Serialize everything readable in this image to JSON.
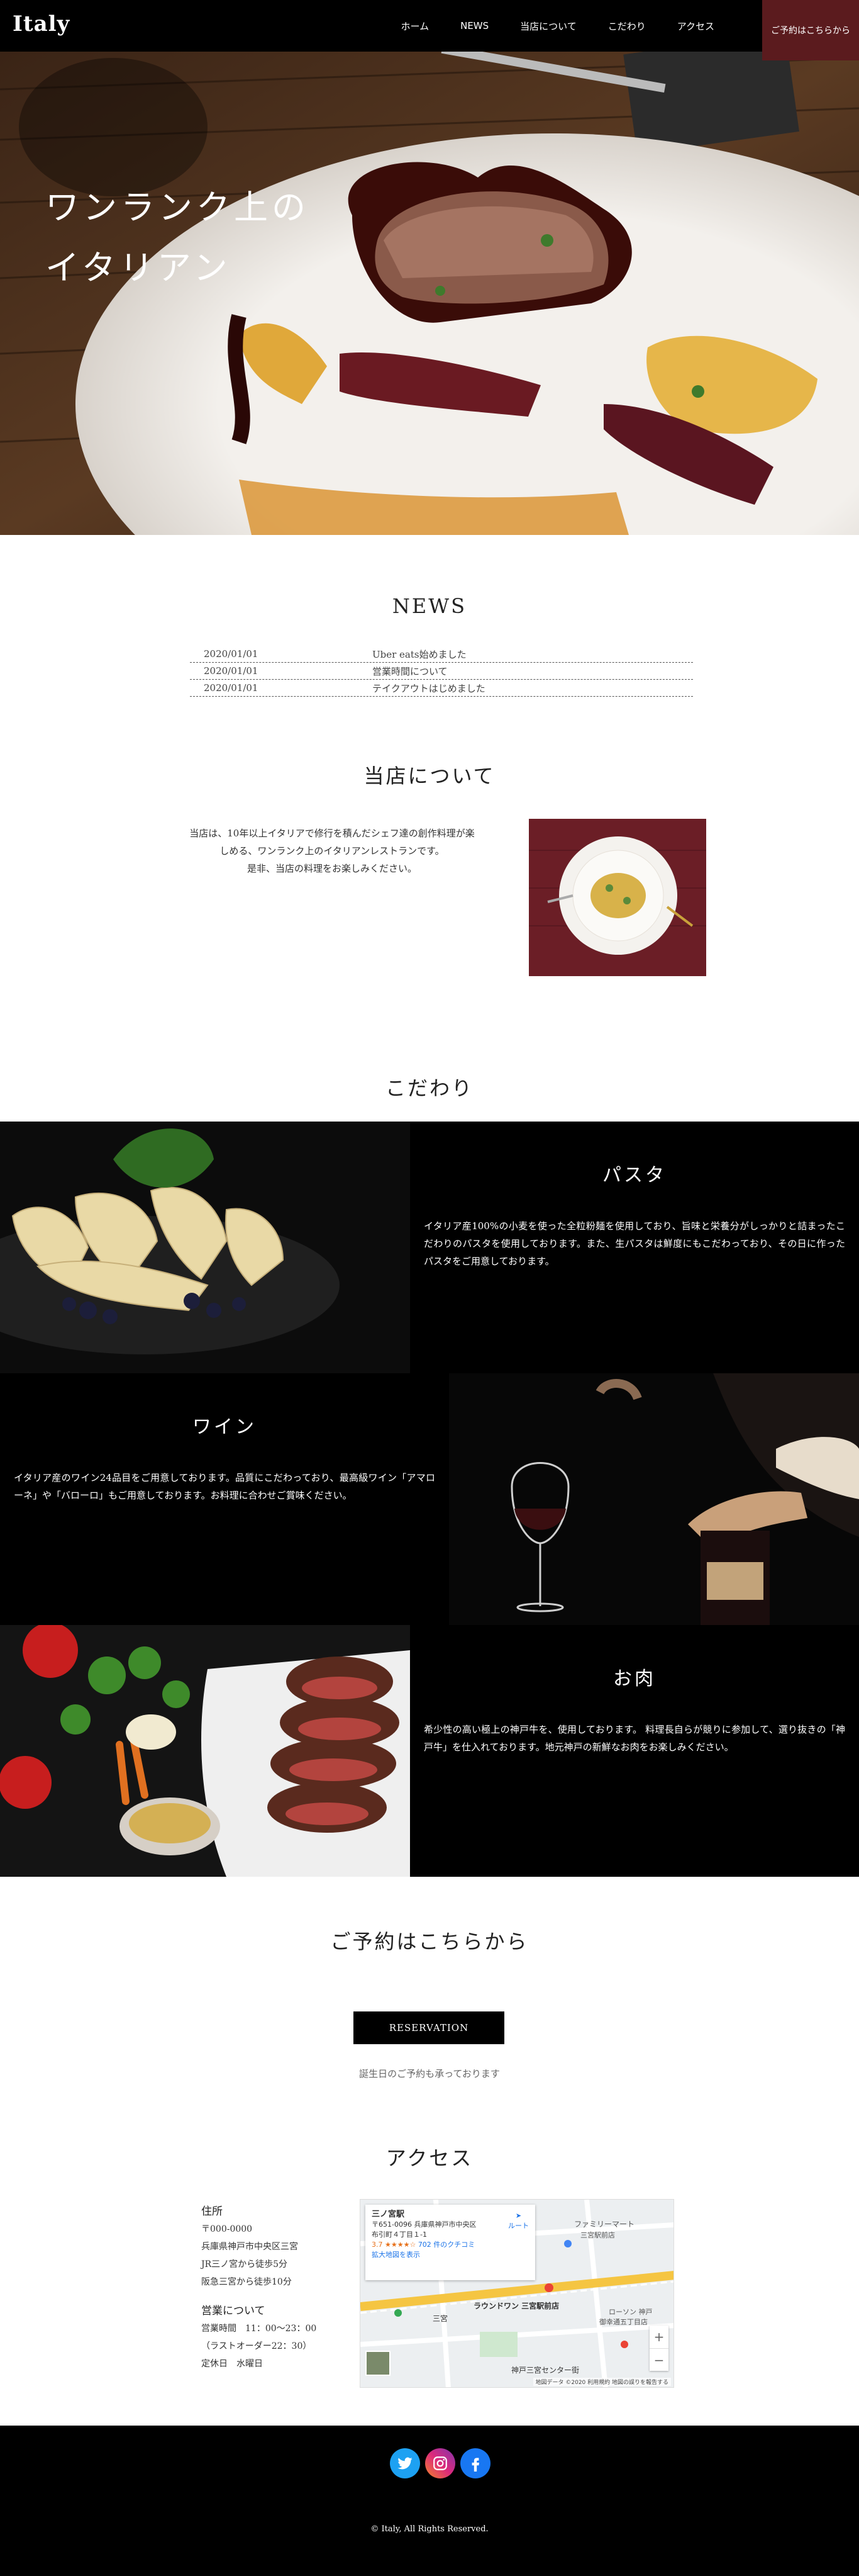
{
  "header": {
    "logo": "Italy",
    "nav": [
      "ホーム",
      "NEWS",
      "当店について",
      "こだわり",
      "アクセス"
    ],
    "reserve_label": "ご予約はこちらから"
  },
  "hero": {
    "title_line1": "ワンランク上の",
    "title_line2": "イタリアン"
  },
  "news": {
    "title": "NEWS",
    "items": [
      {
        "date": "2020/01/01",
        "text": "Uber eats始めました"
      },
      {
        "date": "2020/01/01",
        "text": "営業時間について"
      },
      {
        "date": "2020/01/01",
        "text": "テイクアウトはじめました"
      }
    ]
  },
  "about": {
    "title": "当店について",
    "line1": "当店は、10年以上イタリアで修行を積んだシェフ達の創作料理が楽",
    "line2": "しめる、ワンランク上のイタリアンレストランです。",
    "line3": "是非、当店の料理をお楽しみください。"
  },
  "kodawari": {
    "title": "こだわり",
    "items": [
      {
        "title": "パスタ",
        "text": "イタリア産100%の小麦を使った全粒粉麺を使用しており、旨味と栄養分がしっかりと詰まったこだわりのパスタを使用しております。また、生パスタは鮮度にもこだわっており、その日に作ったパスタをご用意しております。"
      },
      {
        "title": "ワイン",
        "text": "イタリア産のワイン24品目をご用意しております。品質にこだわっており、最高級ワイン「アマローネ」や「バローロ」もご用意しております。お料理に合わせご賞味ください。"
      },
      {
        "title": "お肉",
        "text": "希少性の高い極上の神戸牛を、使用しております。 料理長自らが競りに参加して、選り抜きの「神戸牛」を仕入れております。地元神戸の新鮮なお肉をお楽しみください。"
      }
    ]
  },
  "reserve": {
    "title": "ご予約はこちらから",
    "button": "RESERVATION",
    "note": "誕生日のご予約も承っております"
  },
  "access": {
    "title": "アクセス",
    "address_heading": "住所",
    "address_lines": [
      "〒000-0000",
      "兵庫県神戸市中央区三宮",
      "JR三ノ宮から徒歩5分",
      "阪急三宮から徒歩10分"
    ],
    "hours_heading": "営業について",
    "hours_lines": [
      "営業時間　11：00〜23：00",
      "（ラストオーダー22：30）",
      "定休日　水曜日"
    ]
  },
  "map": {
    "place": "三ノ宮駅",
    "address": "〒651-0096 兵庫県神戸市中央区 布引町４丁目１-1",
    "rating": "3.7",
    "reviews": "702 件のクチコミ",
    "route": "ルート",
    "larger": "拡大地図を表示",
    "labels": [
      "ファミリーマート",
      "三宮駅前店",
      "ラウンドワン 三宮駅前店",
      "ローソン 神戸",
      "御幸通五丁目店",
      "神戸三宮センター街",
      "三宮"
    ],
    "footer": "地図データ ©2020 利用規約 地図の誤りを報告する"
  },
  "footer": {
    "sns": [
      "twitter-icon",
      "instagram-icon",
      "facebook-icon"
    ],
    "copyright": "© Italy, All Rights Reserved."
  },
  "colors": {
    "accent": "#5b1b1e",
    "black": "#000000"
  }
}
